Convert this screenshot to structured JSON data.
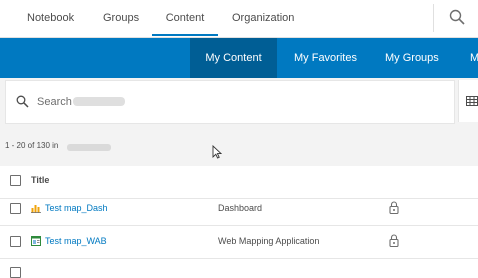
{
  "topnav": {
    "tabs": [
      {
        "label": "Notebook"
      },
      {
        "label": "Groups"
      },
      {
        "label": "Content"
      },
      {
        "label": "Organization"
      }
    ],
    "active_tab": "Content",
    "search_icon": "search-icon"
  },
  "subnav": {
    "tabs": [
      {
        "label": "My Content"
      },
      {
        "label": "My Favorites"
      },
      {
        "label": "My Groups"
      },
      {
        "label": "M"
      }
    ],
    "active_tab": "My Content"
  },
  "search": {
    "placeholder": "Search"
  },
  "results": {
    "count_text": "1 - 20 of 130 in",
    "header": {
      "title": "Title"
    },
    "items": [
      {
        "title": "Test map_Dash",
        "type": "Dashboard",
        "icon": "dashboard-icon"
      },
      {
        "title": "Test map_WAB",
        "type": "Web Mapping Application",
        "icon": "web-app-icon"
      }
    ]
  },
  "colors": {
    "accent": "#0079c1",
    "accent_dark": "#005e95",
    "background_gray": "#f3f3f3"
  }
}
